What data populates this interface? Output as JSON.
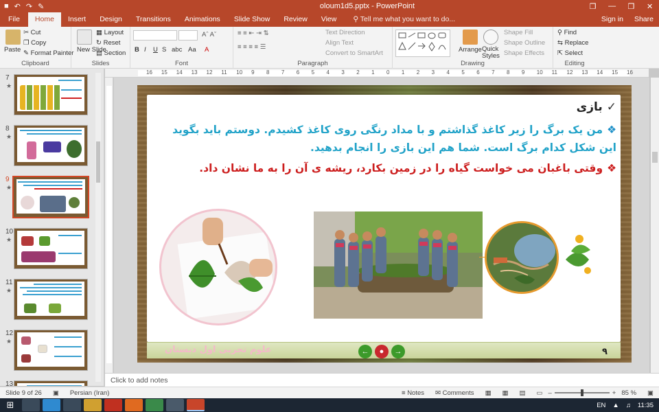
{
  "window": {
    "title": "oloum1d5.pptx - PowerPoint",
    "qat": [
      "↶",
      "↷",
      "✎"
    ],
    "controls": [
      "❐",
      "—",
      "❐",
      "✕"
    ]
  },
  "tabs": [
    {
      "label": "File"
    },
    {
      "label": "Home"
    },
    {
      "label": "Insert"
    },
    {
      "label": "Design"
    },
    {
      "label": "Transitions"
    },
    {
      "label": "Animations"
    },
    {
      "label": "Slide Show"
    },
    {
      "label": "Review"
    },
    {
      "label": "View"
    }
  ],
  "tell_me": "Tell me what you want to do...",
  "account": {
    "signin": "Sign in",
    "share": "Share"
  },
  "ribbon": {
    "clipboard": {
      "label": "Clipboard",
      "paste": "Paste",
      "cut": "Cut",
      "copy": "Copy",
      "format_painter": "Format Painter"
    },
    "slides": {
      "label": "Slides",
      "new_slide": "New Slide",
      "layout": "Layout",
      "reset": "Reset",
      "section": "Section"
    },
    "font": {
      "label": "Font",
      "bold": "B",
      "italic": "I",
      "underline": "U",
      "strike": "S",
      "spacing": "abc",
      "case": "Aa",
      "color": "A"
    },
    "paragraph": {
      "label": "Paragraph",
      "text_direction": "Text Direction",
      "align_text": "Align Text",
      "convert_smartart": "Convert to SmartArt"
    },
    "drawing": {
      "label": "Drawing",
      "arrange": "Arrange",
      "quick_styles": "Quick Styles",
      "shape_fill": "Shape Fill",
      "shape_outline": "Shape Outline",
      "shape_effects": "Shape Effects"
    },
    "editing": {
      "label": "Editing",
      "find": "Find",
      "replace": "Replace",
      "select": "Select"
    }
  },
  "ruler_ticks": [
    "16",
    "15",
    "14",
    "13",
    "12",
    "11",
    "10",
    "9",
    "8",
    "7",
    "6",
    "5",
    "4",
    "3",
    "2",
    "1",
    "0",
    "1",
    "2",
    "3",
    "4",
    "5",
    "6",
    "7",
    "8",
    "9",
    "10",
    "11",
    "12",
    "13",
    "14",
    "15",
    "16"
  ],
  "thumbnails": [
    {
      "num": "7",
      "star": "★",
      "active": false
    },
    {
      "num": "8",
      "star": "★",
      "active": false
    },
    {
      "num": "9",
      "star": "★",
      "active": true
    },
    {
      "num": "10",
      "star": "★",
      "active": false
    },
    {
      "num": "11",
      "star": "★",
      "active": false
    },
    {
      "num": "12",
      "star": "★",
      "active": false
    },
    {
      "num": "13",
      "star": "",
      "active": false
    }
  ],
  "slide": {
    "heading": "بازی",
    "check": "✓",
    "bullet": "❖",
    "para1": "من یک برگ را زیر کاغذ گذاشتم و با مداد رنگی روی کاغذ کشیدم. دوستم باید بگوید این شکل کدام برگ است. شما هم این بازی را انجام بدهید.",
    "para2": "وقتی باغبان می خواست گیاه را در زمین بکارد، ریشه ی آن را به ما نشان داد.",
    "footer_text": "علوم تجربی اول دبستان",
    "page_number": "۹",
    "nav": {
      "prev": "←",
      "home": "●",
      "next": "→"
    }
  },
  "notes_placeholder": "Click to add notes",
  "status": {
    "slide_info": "Slide 9 of 26",
    "language": "Persian (Iran)",
    "notes": "Notes",
    "comments": "Comments",
    "zoom": "85 %"
  },
  "taskbar": {
    "lang": "EN",
    "time": "11:35"
  },
  "colors": {
    "accent": "#b7472a",
    "para_blue": "#20a2c8",
    "para_red": "#cc1d1d"
  }
}
